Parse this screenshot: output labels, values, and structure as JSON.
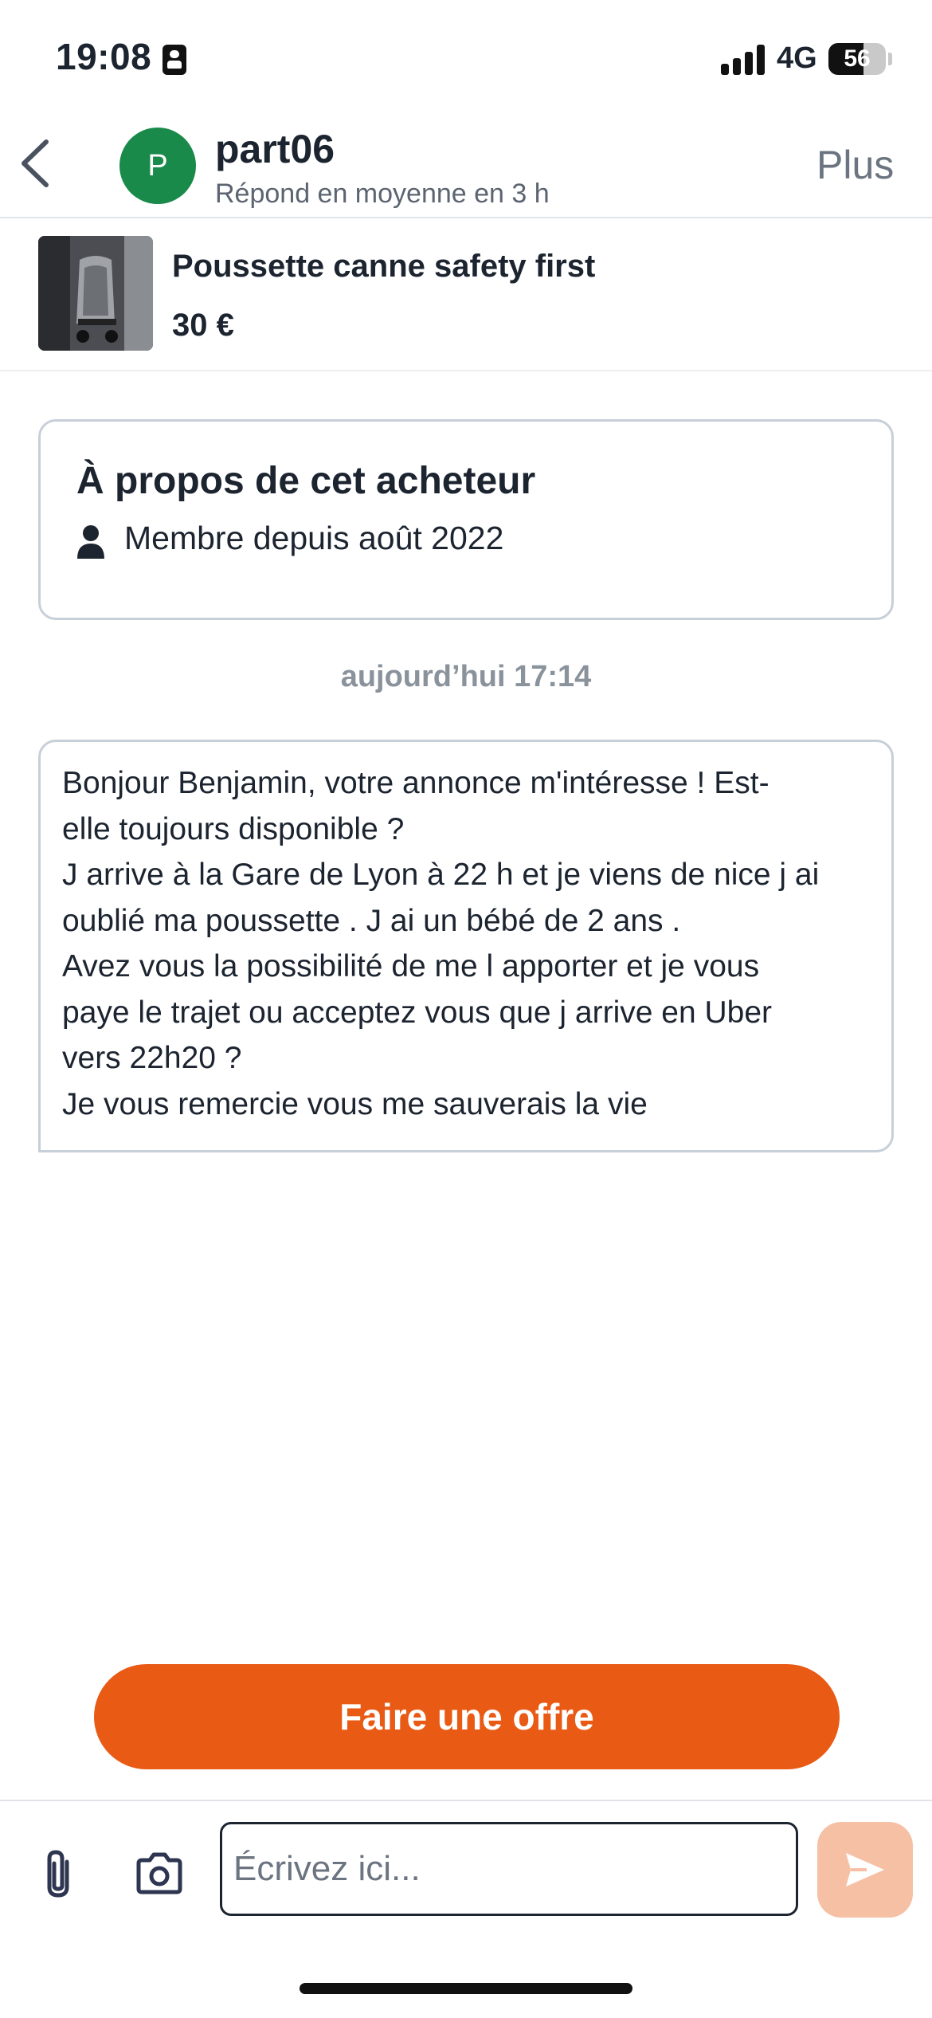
{
  "status_bar": {
    "time": "19:08",
    "network": "4G",
    "battery": "56"
  },
  "header": {
    "avatar_letter": "P",
    "user_name": "part06",
    "response_time": "Répond en moyenne en 3 h",
    "more_label": "Plus"
  },
  "listing": {
    "title": "Poussette canne safety first",
    "price": "30 €"
  },
  "about": {
    "title": "À propos de cet acheteur",
    "member_since": "Membre depuis août 2022"
  },
  "conversation": {
    "date_label": "aujourd’hui 17:14",
    "message_lines": [
      "Bonjour Benjamin, votre annonce m'intéresse ! Est-",
      "elle toujours disponible ?",
      "J arrive à la Gare de Lyon à 22 h et je viens de nice j ai",
      "oublié ma poussette . J ai un bébé de 2 ans .",
      "Avez vous la possibilité de me l apporter et je vous",
      "paye le trajet ou acceptez vous que j arrive en Uber",
      "vers 22h20 ?",
      "Je vous remercie vous me sauverais la vie"
    ]
  },
  "actions": {
    "offer_label": "Faire une offre"
  },
  "compose": {
    "placeholder": "Écrivez ici..."
  },
  "colors": {
    "accent": "#e95a15",
    "send_disabled": "#f6c0a4",
    "avatar": "#1a8a4a"
  },
  "icons": [
    "sim-card-icon",
    "signal-icon",
    "battery-icon",
    "back-chevron-icon",
    "person-icon",
    "paperclip-icon",
    "camera-icon",
    "send-icon"
  ]
}
